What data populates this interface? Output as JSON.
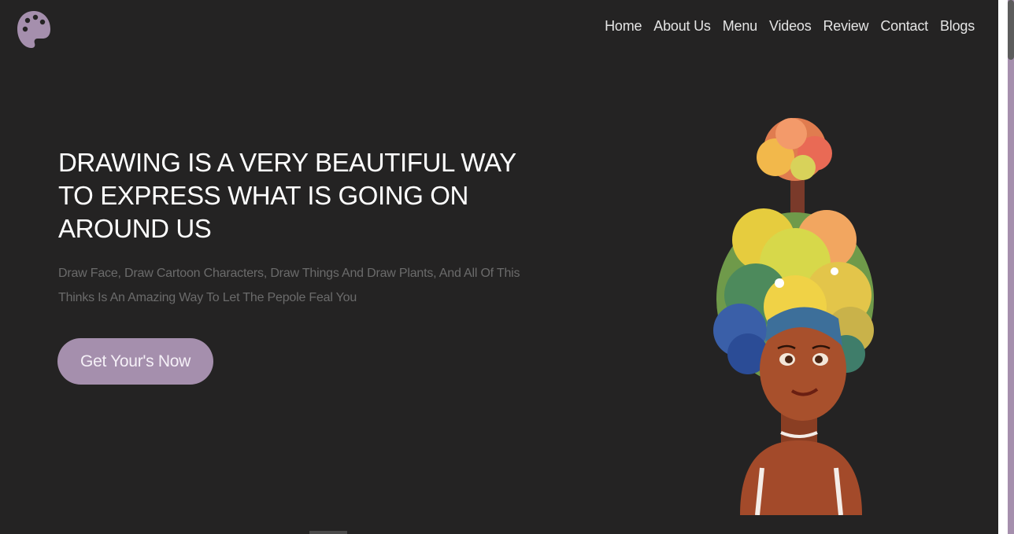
{
  "header": {
    "logo_icon": "palette-icon",
    "nav": [
      {
        "label": "Home"
      },
      {
        "label": "About Us"
      },
      {
        "label": "Menu"
      },
      {
        "label": "Videos"
      },
      {
        "label": "Review"
      },
      {
        "label": "Contact"
      },
      {
        "label": "Blogs"
      }
    ]
  },
  "hero": {
    "title": "DRAWING IS A VERY BEAUTIFUL WAY TO EXPRESS WHAT IS GOING ON AROUND US",
    "subtitle": "Draw Face, Draw Cartoon Characters, Draw Things And Draw Plants, And All Of This Thinks Is An Amazing Way To Let The Pepole Feal You",
    "cta_label": "Get Your's Now",
    "image_icon": "character-illustration"
  },
  "colors": {
    "background": "#242323",
    "accent": "#a58fad",
    "text": "#ffffff",
    "muted": "#6b6b6b"
  }
}
